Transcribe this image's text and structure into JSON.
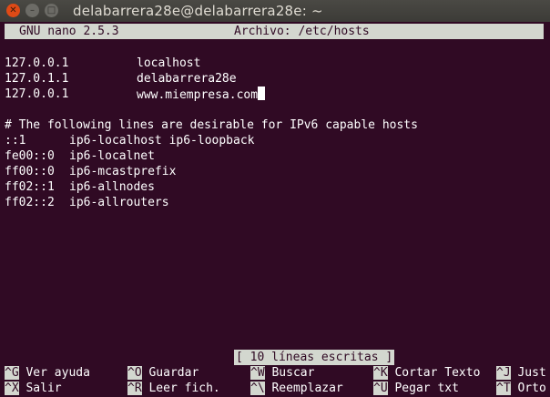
{
  "window": {
    "title": "delabarrera28e@delabarrera28e: ~"
  },
  "nano": {
    "version": "GNU nano 2.5.3",
    "file": "Archivo: /etc/hosts"
  },
  "lines": [
    {
      "a": "127.0.0.1",
      "b": "localhost"
    },
    {
      "a": "127.0.1.1",
      "b": "delabarrera28e"
    },
    {
      "a": "127.0.0.1",
      "b": "www.miempresa.com"
    },
    {
      "a": "",
      "b": ""
    },
    {
      "a": "# The following lines are desirable for IPv6 capable hosts",
      "b": ""
    },
    {
      "a": "::1",
      "b": "ip6-localhost ip6-loopback"
    },
    {
      "a": "fe00::0",
      "b": "ip6-localnet"
    },
    {
      "a": "ff00::0",
      "b": "ip6-mcastprefix"
    },
    {
      "a": "ff02::1",
      "b": "ip6-allnodes"
    },
    {
      "a": "ff02::2",
      "b": "ip6-allrouters"
    }
  ],
  "status": "[ 10 líneas escritas ]",
  "shortcuts": [
    [
      {
        "key": "^G",
        "label": "Ver ayuda"
      },
      {
        "key": "^O",
        "label": "Guardar"
      },
      {
        "key": "^W",
        "label": "Buscar"
      },
      {
        "key": "^K",
        "label": "Cortar Texto"
      },
      {
        "key": "^J",
        "label": "Just"
      }
    ],
    [
      {
        "key": "^X",
        "label": "Salir"
      },
      {
        "key": "^R",
        "label": "Leer fich."
      },
      {
        "key": "^\\",
        "label": "Reemplazar"
      },
      {
        "key": "^U",
        "label": "Pegar txt"
      },
      {
        "key": "^T",
        "label": "Orto"
      }
    ]
  ]
}
